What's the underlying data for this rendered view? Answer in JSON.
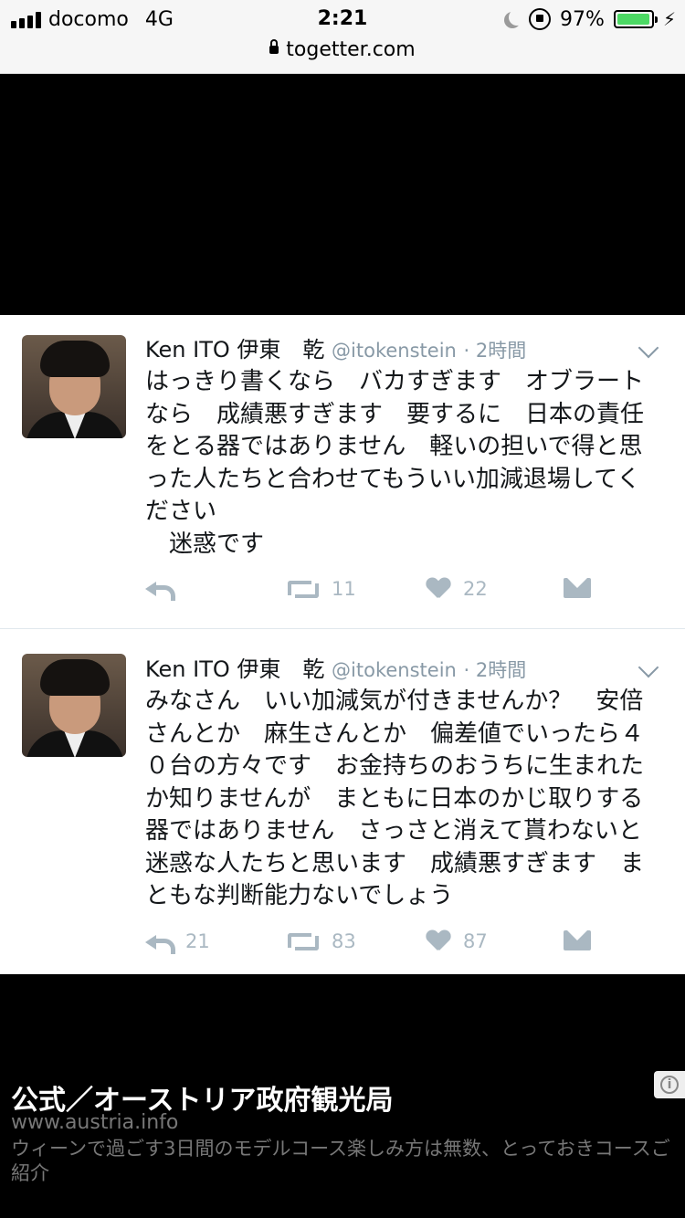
{
  "status_bar": {
    "carrier": "docomo",
    "network": "4G",
    "time": "2:21",
    "battery": "97%",
    "battery_level": 0.97,
    "url": "togetter.com"
  },
  "tweets": [
    {
      "name": "Ken ITO 伊東　乾",
      "handle": "@itokenstein",
      "time": "· 2時間",
      "text": "はっきり書くなら　バカすぎます　オブラートなら　成績悪すぎます　要するに　日本の責任をとる器ではありません　軽いの担いで得と思った人たちと合わせてもういい加減退場してください\n　迷惑です",
      "replies": "",
      "retweets": "11",
      "likes": "22"
    },
    {
      "name": "Ken ITO 伊東　乾",
      "handle": "@itokenstein",
      "time": "· 2時間",
      "text": "みなさん　いい加減気が付きませんか？　安倍さんとか　麻生さんとか　偏差値でいったら４０台の方々です　お金持ちのおうちに生まれたか知りませんが　まともに日本のかじ取りする器ではありません　さっさと消えて貰わないと　迷惑な人たちと思います　成績悪すぎます　まともな判断能力ないでしょう",
      "replies": "21",
      "retweets": "83",
      "likes": "87"
    }
  ],
  "ad": {
    "title": "公式／オーストリア政府観光局",
    "domain": "www.austria.info",
    "description": "ウィーンで過ごす3日間のモデルコース楽しみ方は無数、とっておきコースご紹介",
    "info_icon": "info-icon"
  },
  "colors": {
    "text": "#14171a",
    "secondary": "#8899a6",
    "action": "#aab8c2",
    "battery": "#4cd964"
  }
}
